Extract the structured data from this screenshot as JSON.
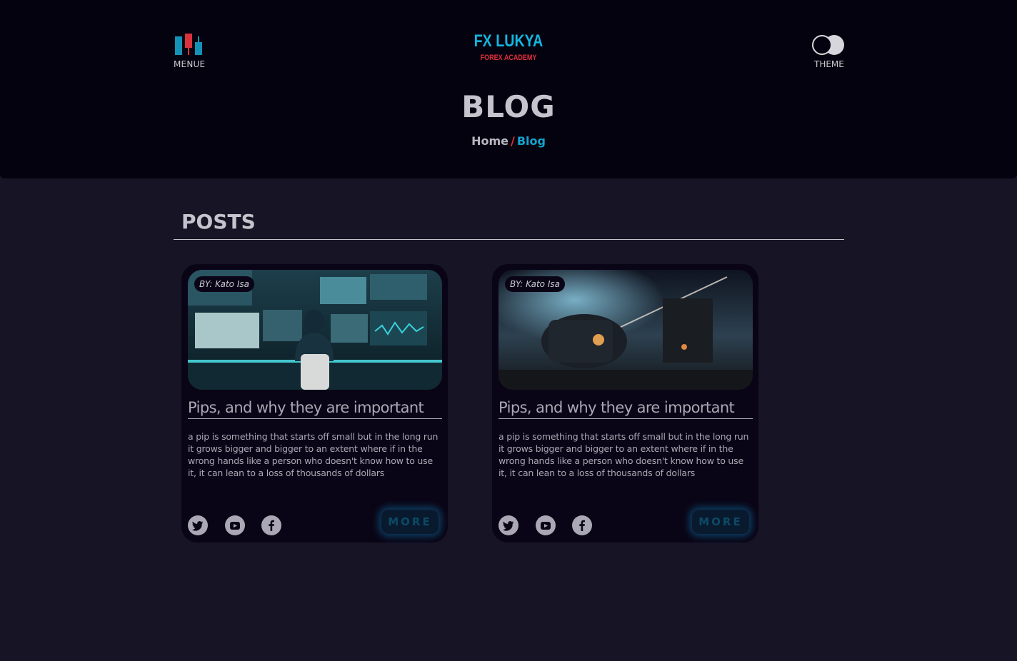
{
  "header": {
    "menu_label": "MENUE",
    "logo_title": "FX LUKYA",
    "logo_subtitle": "FOREX ACADEMY",
    "theme_label": "THEME",
    "page_title": "BLOG",
    "breadcrumb": {
      "home": "Home",
      "separator": "/",
      "current": "Blog"
    }
  },
  "posts": {
    "heading": "POSTS",
    "items": [
      {
        "author": "BY: Kato Isa",
        "image_icon": "trader-workstation-image",
        "title": "Pips, and why they are important",
        "excerpt": "a pip is something that starts off small but in the long run it grows bigger and bigger to an extent where if in the wrong hands like a person who doesn't know how to use it, it can lean to a loss of thousands of dollars",
        "more_label": "MORE",
        "social_icons": [
          "twitter-icon",
          "youtube-icon",
          "facebook-icon"
        ]
      },
      {
        "author": "BY: Kato Isa",
        "image_icon": "space-station-image",
        "title": "Pips, and why they are important",
        "excerpt": "a pip is something that starts off small but in the long run it grows bigger and bigger to an extent where if in the wrong hands like a person who doesn't know how to use it, it can lean to a loss of thousands of dollars",
        "more_label": "MORE",
        "social_icons": [
          "twitter-icon",
          "youtube-icon",
          "facebook-icon"
        ]
      }
    ]
  },
  "colors": {
    "header_bg": "#05020f",
    "page_bg": "#171425",
    "card_bg": "#0a0516",
    "accent_cyan": "#13b6e0",
    "accent_red": "#e2303a",
    "text_light": "#c5c4cc"
  }
}
